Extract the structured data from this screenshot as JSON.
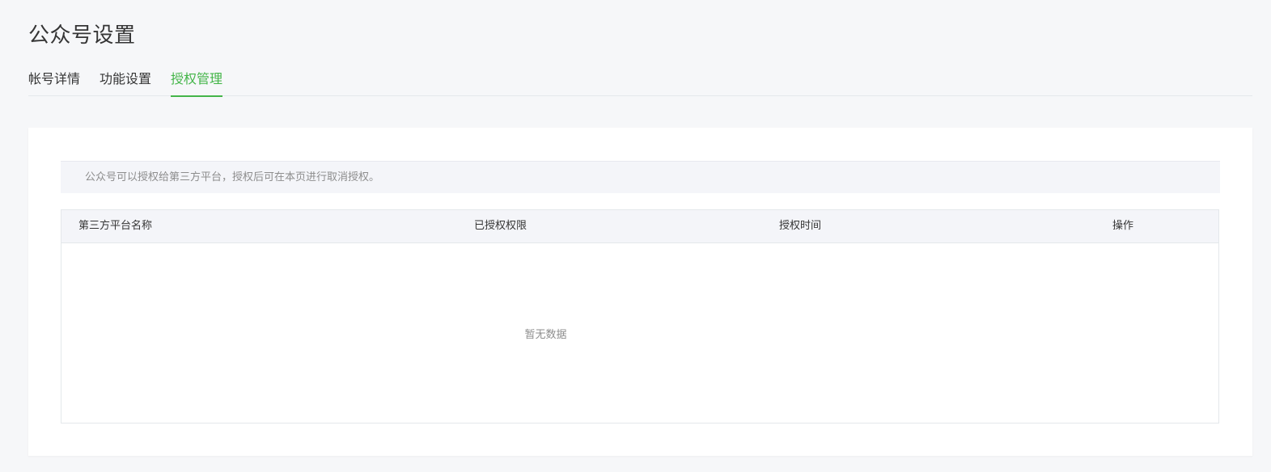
{
  "page": {
    "title": "公众号设置"
  },
  "tabs": [
    {
      "label": "帐号详情",
      "active": false
    },
    {
      "label": "功能设置",
      "active": false
    },
    {
      "label": "授权管理",
      "active": true
    }
  ],
  "notice": {
    "text": "公众号可以授权给第三方平台，授权后可在本页进行取消授权。"
  },
  "table": {
    "columns": [
      "第三方平台名称",
      "已授权权限",
      "授权时间",
      "操作"
    ],
    "rows": [],
    "empty_text": "暂无数据"
  },
  "colors": {
    "accent": "#44b549",
    "background": "#f6f7f9",
    "text": "#353535",
    "muted_text": "#8d8d8d",
    "header_bg": "#f4f5f9"
  }
}
